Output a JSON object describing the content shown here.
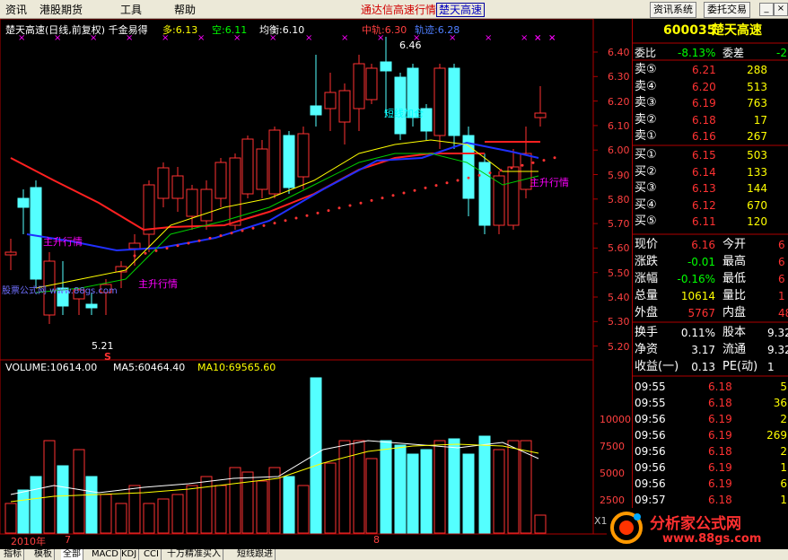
{
  "menu": [
    "资讯",
    "港股期货",
    "工具",
    "帮助"
  ],
  "app_title": "通达信高速行情",
  "app_stock": "楚天高速",
  "buttons": {
    "trade_info": "资讯系统",
    "entrust": "委托交易"
  },
  "chart": {
    "header_name": "楚天高速(日线,前复权) 千金易得",
    "duo": "多:6.13",
    "kong": "空:6.11",
    "junheng": "均衡:6.10",
    "zhongxian": "中轨:6.30",
    "guiji": "轨迹:6.28",
    "high_label": "6.46",
    "low_label": "5.21",
    "ann_short": "短线加仓",
    "ann_rise1": "主升行情",
    "ann_rise2": "主升行情",
    "ann_rise3": "主升行情",
    "ann_watermark": "股票公式网 www.88gs.com",
    "price_axis": [
      "6.40",
      "6.30",
      "6.20",
      "6.10",
      "6.00",
      "5.90",
      "5.80",
      "5.70",
      "5.60",
      "5.50",
      "5.40",
      "5.30",
      "5.20"
    ],
    "volume_header": {
      "volume": "VOLUME:10614.00",
      "ma5": "MA5:60464.40",
      "ma10": "MA10:69565.60"
    },
    "volume_axis": [
      "10000",
      "7500",
      "5000",
      "2500"
    ],
    "volume_unit": "X10",
    "date_labels": {
      "year": "2010年",
      "m7": "7",
      "m8": "8"
    },
    "s_marker": "S"
  },
  "quote": {
    "code": "600035",
    "name": "楚天高速",
    "weibi_label": "委比",
    "weibi_value": "-8.13%",
    "weicha_label": "委差",
    "weicha_value": "-2",
    "sell": [
      {
        "label": "卖⑤",
        "price": "6.21",
        "vol": "288"
      },
      {
        "label": "卖④",
        "price": "6.20",
        "vol": "513"
      },
      {
        "label": "卖③",
        "price": "6.19",
        "vol": "763"
      },
      {
        "label": "卖②",
        "price": "6.18",
        "vol": "17"
      },
      {
        "label": "卖①",
        "price": "6.16",
        "vol": "267"
      }
    ],
    "buy": [
      {
        "label": "买①",
        "price": "6.15",
        "vol": "503"
      },
      {
        "label": "买②",
        "price": "6.14",
        "vol": "133"
      },
      {
        "label": "买③",
        "price": "6.13",
        "vol": "144"
      },
      {
        "label": "买④",
        "price": "6.12",
        "vol": "670"
      },
      {
        "label": "买⑤",
        "price": "6.11",
        "vol": "120"
      }
    ],
    "stats": [
      {
        "l1": "现价",
        "v1": "6.16",
        "l2": "今开",
        "v2": "6"
      },
      {
        "l1": "涨跌",
        "v1": "-0.01",
        "l2": "最高",
        "v2": "6"
      },
      {
        "l1": "涨幅",
        "v1": "-0.16%",
        "l2": "最低",
        "v2": "6"
      },
      {
        "l1": "总量",
        "v1": "10614",
        "l2": "量比",
        "v2": "1"
      },
      {
        "l1": "外盘",
        "v1": "5767",
        "l2": "内盘",
        "v2": "48"
      }
    ],
    "stats2": [
      {
        "l1": "换手",
        "v1": "0.11%",
        "l2": "股本",
        "v2": "9.32"
      },
      {
        "l1": "净资",
        "v1": "3.17",
        "l2": "流通",
        "v2": "9.32"
      },
      {
        "l1": "收益(一)",
        "v1": "0.13",
        "l2": "PE(动)",
        "v2": "1"
      }
    ],
    "ticks": [
      {
        "time": "09:55",
        "price": "6.18",
        "vol": "5"
      },
      {
        "time": "09:55",
        "price": "6.18",
        "vol": "36"
      },
      {
        "time": "09:56",
        "price": "6.19",
        "vol": "2"
      },
      {
        "time": "09:56",
        "price": "6.19",
        "vol": "269"
      },
      {
        "time": "09:56",
        "price": "6.18",
        "vol": "2"
      },
      {
        "time": "09:56",
        "price": "6.19",
        "vol": "1"
      },
      {
        "time": "09:56",
        "price": "6.19",
        "vol": "6"
      },
      {
        "time": "09:57",
        "price": "6.18",
        "vol": "1"
      }
    ]
  },
  "tabs": [
    "指标",
    "模板",
    "全部",
    "MACD",
    "KDJ",
    "CCI",
    "十万精准买入",
    "短线跟进"
  ],
  "logo": {
    "text": "分析家公式网",
    "url": "www.88gs.com"
  },
  "colors": {
    "up": "#ff3232",
    "down": "#54ffff",
    "pink": "#ff00ff",
    "green": "#00cc00",
    "yellow": "#ffff00"
  }
}
